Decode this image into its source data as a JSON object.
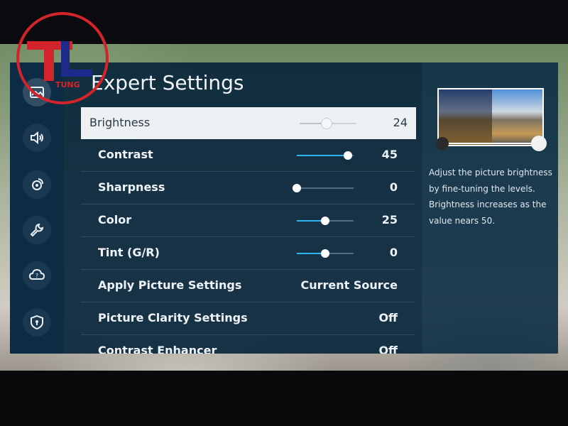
{
  "title": "Expert Settings",
  "rows": [
    {
      "label": "Brightness",
      "value": "24"
    },
    {
      "label": "Contrast",
      "value": "45"
    },
    {
      "label": "Sharpness",
      "value": "0"
    },
    {
      "label": "Color",
      "value": "25"
    },
    {
      "label": "Tint (G/R)",
      "value": "0"
    },
    {
      "label": "Apply Picture Settings",
      "value": "Current Source"
    },
    {
      "label": "Picture Clarity Settings",
      "value": "Off"
    },
    {
      "label": "Contrast Enhancer",
      "value": "Off"
    }
  ],
  "sliders": {
    "brightness": {
      "value": 24,
      "max": 50
    },
    "contrast": {
      "value": 45,
      "max": 50
    },
    "sharpness": {
      "value": 0,
      "max": 20
    },
    "color": {
      "value": 25,
      "max": 50
    },
    "tint": {
      "value": 0,
      "min": -50,
      "max": 50
    }
  },
  "help": {
    "text": "Adjust the picture brightness by fine-tuning the levels. Brightness increases as the value nears 50."
  },
  "logo": {
    "letters": "TL",
    "subtext": "TUNG"
  },
  "sidebar_icons": [
    "picture-icon",
    "sound-icon",
    "broadcasting-icon",
    "wrench-icon",
    "support-icon",
    "privacy-icon"
  ],
  "colors": {
    "accent": "#2bb5f2",
    "panel": "#09263c",
    "selected_row": "#eef1f3",
    "logo_red": "#d3242b",
    "logo_blue": "#1d2a8c"
  }
}
